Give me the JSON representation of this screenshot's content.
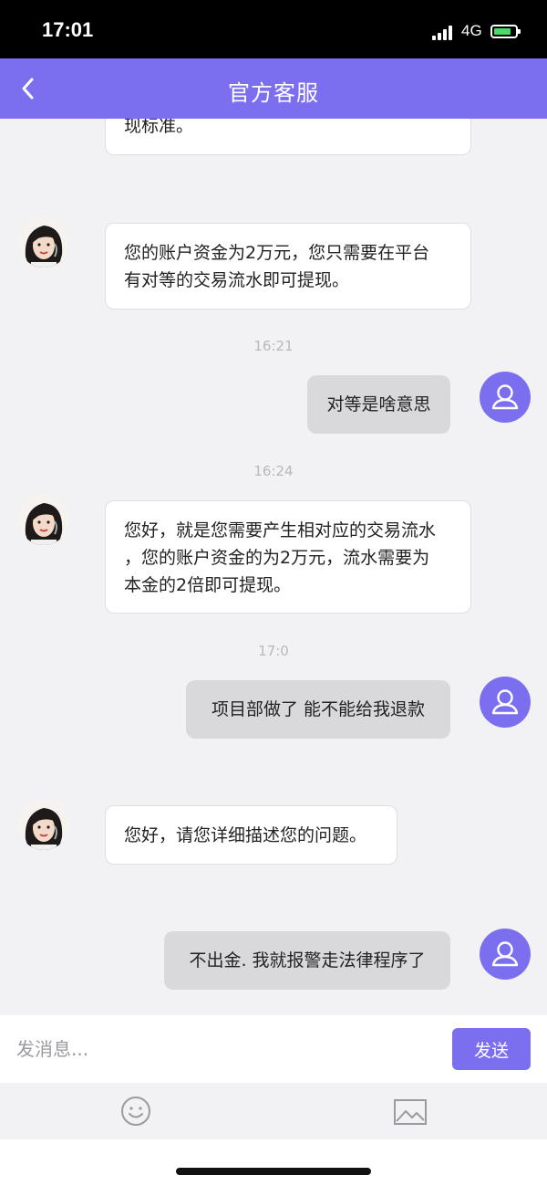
{
  "status_bar": {
    "time": "17:01",
    "network": "4G"
  },
  "header": {
    "title": "官方客服"
  },
  "messages": [
    {
      "sender": "agent",
      "lines": [
        "现标准。"
      ]
    },
    {
      "sender": "agent",
      "lines": [
        "您的账户资金为2万元，您只需要在平台",
        "有对等的交易流水即可提现。"
      ]
    },
    {
      "type": "time",
      "text": "16:21"
    },
    {
      "sender": "user",
      "text": "对等是啥意思"
    },
    {
      "type": "time",
      "text": "16:24"
    },
    {
      "sender": "agent",
      "lines": [
        "您好，就是您需要产生相对应的交易流水",
        "，您的账户资金的为2万元，流水需要为",
        "本金的2倍即可提现。"
      ]
    },
    {
      "type": "time",
      "text": "17:0"
    },
    {
      "sender": "user",
      "text": "项目部做了 能不能给我退款"
    },
    {
      "sender": "agent",
      "lines": [
        "您好，请您详细描述您的问题。"
      ]
    },
    {
      "sender": "user",
      "text": "不出金. 我就报警走法律程序了"
    }
  ],
  "input": {
    "placeholder": "发消息...",
    "send_label": "发送"
  },
  "icons": {
    "back": "chevron-left-icon",
    "user_avatar": "person-icon",
    "emoji": "smiley-icon",
    "image": "image-icon"
  },
  "colors": {
    "accent": "#7b6ff0",
    "user_bubble": "#d9d9dc",
    "agent_bubble": "#ffffff",
    "chat_background": "#f2f2f4",
    "timestamp": "#b8b8bd"
  }
}
